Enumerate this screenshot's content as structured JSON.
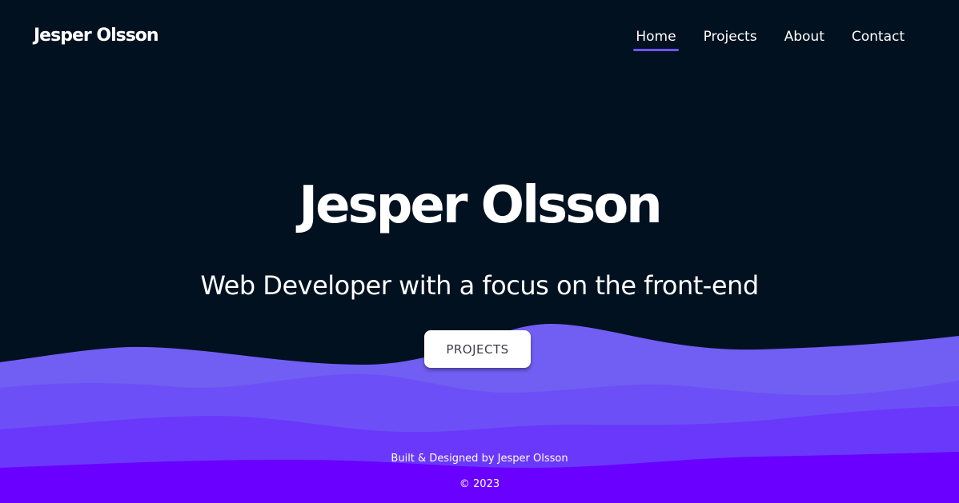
{
  "header": {
    "brand": "Jesper Olsson",
    "nav": [
      {
        "label": "Home",
        "active": true
      },
      {
        "label": "Projects",
        "active": false
      },
      {
        "label": "About",
        "active": false
      },
      {
        "label": "Contact",
        "active": false
      }
    ]
  },
  "hero": {
    "title": "Jesper Olsson",
    "subtitle": "Web Developer with a focus on the front-end",
    "button_label": "PROJECTS"
  },
  "footer": {
    "credit": "Built & Designed by Jesper Olsson",
    "copyright": "© 2023"
  },
  "colors": {
    "background": "#011120",
    "accent": "#6e55f5",
    "wave_1": "#715ef2",
    "wave_2": "#6c4ff7",
    "wave_3": "#6a38fb",
    "wave_4": "#6a00ff"
  }
}
